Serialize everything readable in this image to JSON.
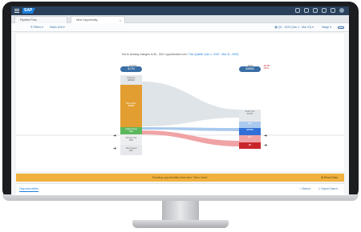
{
  "shell": {
    "logo_text": "SAP",
    "icons": [
      "menu-icon",
      "search-icon",
      "bell-icon",
      "help-icon",
      "gear-icon",
      "user-avatar"
    ]
  },
  "tabs": [
    {
      "label": "Pipeline Flow"
    },
    {
      "label": "Next Opportunity..."
    }
  ],
  "toolbar": {
    "filters_label": "⊽ Filters ▾",
    "scope_label": "Sales Unit ▾",
    "range_label": "▦ Q1 - 2022 (Jan 1 - Mar 31) ▾",
    "value_label": "Stage ▾"
  },
  "caption": {
    "prefix": "You're viewing changes to $1 - $1/2 opportunities over:",
    "range": "This Quarter (Jan 1, 2022 - Mar 31, 2022)"
  },
  "flow": {
    "start_label": "START",
    "start_value": "$17M",
    "end_label": "END",
    "end_value": "$368M",
    "delta_lines": [
      "-$17B",
      "-30%"
    ],
    "start_segments": [
      {
        "label": "Pipeline",
        "value": "$680M"
      },
      {
        "label": "Won Flow",
        "value": "$28M"
      },
      {
        "label": "Added Flow",
        "value": "$28"
      },
      {
        "label": "Moved Out",
        "value": "$50"
      },
      {
        "label": "Decreased",
        "value": "$40"
      }
    ],
    "end_segments": [
      {
        "label": "Push Out",
        "value": "$17M"
      },
      {
        "label": "Added",
        "value": "$10"
      },
      {
        "label": "Won",
        "value": "$355M"
      },
      {
        "label": "Lost",
        "value": "$14"
      },
      {
        "label": "Closed",
        "value": "$0"
      }
    ]
  },
  "banner": {
    "text": "Showing opportunities that were \"Won Lines\"",
    "button": "⊠ Reset Data"
  },
  "bottom": {
    "tab": "Opportunities",
    "search": "⌕ Search",
    "export": "⇩ Export Data ▾"
  },
  "colors": {
    "shell": "#2a3f5a",
    "accent": "#1a7fdc",
    "won": "#e29e31",
    "added": "#5bb85d",
    "lost": "#d93b3b",
    "banner": "#f0b13f"
  }
}
